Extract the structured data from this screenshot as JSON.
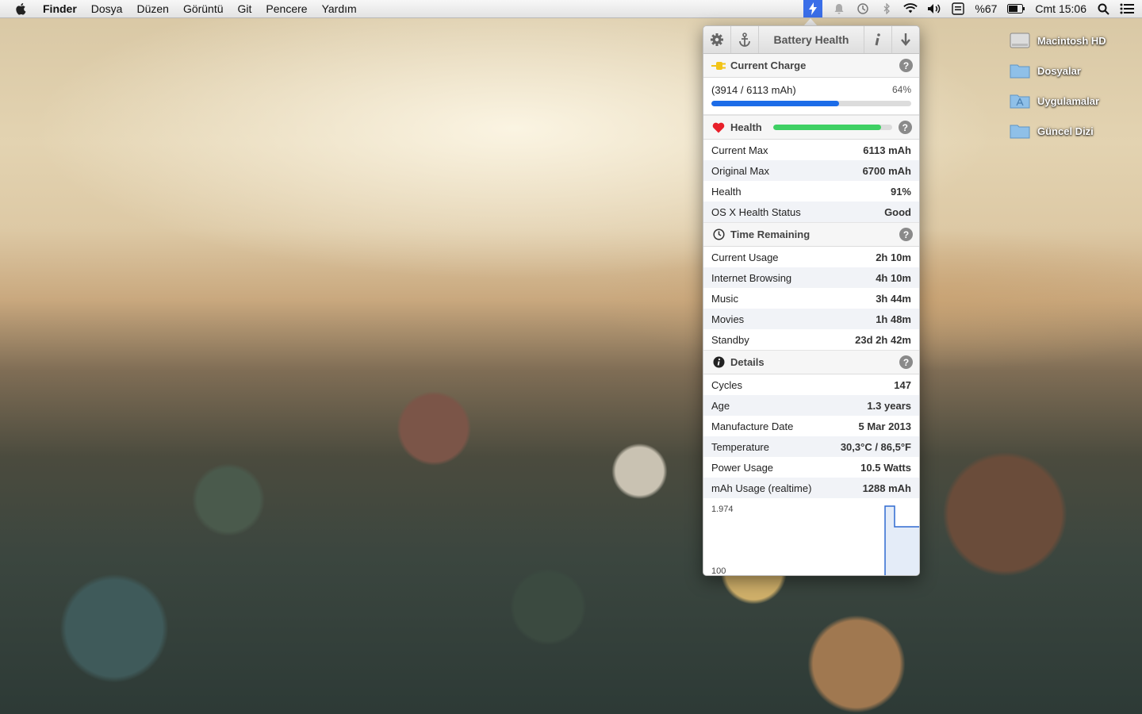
{
  "menubar": {
    "app": "Finder",
    "items": [
      "Dosya",
      "Düzen",
      "Görüntü",
      "Git",
      "Pencere",
      "Yardım"
    ],
    "battery_percent": "%67",
    "clock": "Cmt 15:06"
  },
  "desktop": {
    "items": [
      "Macintosh HD",
      "Dosyalar",
      "Uygulamalar",
      "Güncel Dizi"
    ]
  },
  "popover": {
    "title": "Battery Health",
    "current_charge": {
      "header": "Current Charge",
      "detail": "(3914 / 6113 mAh)",
      "percent_label": "64%",
      "fill_fraction": 0.64
    },
    "health": {
      "header": "Health",
      "fill_fraction": 0.91,
      "rows": [
        {
          "label": "Current Max",
          "value": "6113 mAh"
        },
        {
          "label": "Original Max",
          "value": "6700 mAh"
        },
        {
          "label": "Health",
          "value": "91%"
        },
        {
          "label": "OS X Health Status",
          "value": "Good"
        }
      ]
    },
    "time_remaining": {
      "header": "Time Remaining",
      "rows": [
        {
          "label": "Current Usage",
          "value": "2h 10m"
        },
        {
          "label": "Internet Browsing",
          "value": "4h 10m"
        },
        {
          "label": "Music",
          "value": "3h 44m"
        },
        {
          "label": "Movies",
          "value": "1h 48m"
        },
        {
          "label": "Standby",
          "value": "23d 2h 42m"
        }
      ]
    },
    "details": {
      "header": "Details",
      "rows": [
        {
          "label": "Cycles",
          "value": "147"
        },
        {
          "label": "Age",
          "value": "1.3 years"
        },
        {
          "label": "Manufacture Date",
          "value": "5 Mar 2013"
        },
        {
          "label": "Temperature",
          "value": "30,3°C / 86,5°F"
        },
        {
          "label": "Power Usage",
          "value": "10.5 Watts"
        },
        {
          "label": "mAh Usage (realtime)",
          "value": "1288 mAh"
        }
      ]
    },
    "graph": {
      "top_label": "1.974",
      "bottom_label": "100"
    },
    "colors": {
      "charge_bar": "#1c6ce8",
      "health_bar": "#3fd064",
      "heart": "#e8202a",
      "plug": "#f2c418"
    }
  }
}
